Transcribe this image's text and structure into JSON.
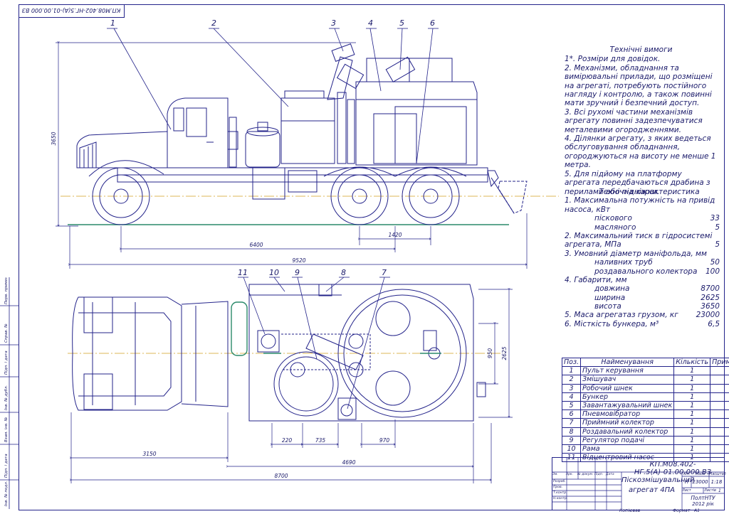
{
  "stamp_top": "КП.М08.402-НГ.5(А)-01.00.000 ВЗ",
  "tech_requirements": {
    "title": "Технічні вимоги",
    "items": [
      "1*. Розміри для довідок.",
      "2. Механізми, обладнання та вимірювальні прилади, що розміщені на агрегаті, потребують постійного нагляду і контролю, а також повинні мати зручний і безпечний доступ.",
      "3. Всі рухомі частини механізмів агрегату повинні задезпечуватися металевими огородженнями.",
      "4. Ділянки агрегату, з яких ведеться обслуговування обладнання, огороджуються на висоту не менше 1 метра.",
      "5. Для підйому на платформу агрегата передбачаються драбина з перилами або підніжки."
    ]
  },
  "specs": {
    "title": "Технічна характеристика",
    "rows": [
      {
        "label": "1. Максимальна потужність на привід",
        "value": ""
      },
      {
        "label": "насоса, кВт",
        "value": ""
      },
      {
        "label": "піскового",
        "value": "33",
        "indent": true
      },
      {
        "label": "масляного",
        "value": "5",
        "indent": true
      },
      {
        "label": "2. Максимальний тиск в гідросистемі",
        "value": ""
      },
      {
        "label": "агрегата, МПа",
        "value": "5"
      },
      {
        "label": "3. Умовний діаметр маніфольда, мм",
        "value": ""
      },
      {
        "label": "наливних труб",
        "value": "50",
        "indent": true
      },
      {
        "label": "роздавального колектора",
        "value": "100",
        "indent": true
      },
      {
        "label": "4. Габарити, мм",
        "value": ""
      },
      {
        "label": "довжина",
        "value": "8700",
        "indent": true
      },
      {
        "label": "ширина",
        "value": "2625",
        "indent": true
      },
      {
        "label": "висота",
        "value": "3650",
        "indent": true
      },
      {
        "label": "5. Маса агрегатаз грузом, кг",
        "value": "23000"
      },
      {
        "label": "6. Місткість бункера, м³",
        "value": "6,5"
      }
    ]
  },
  "parts_table": {
    "headers": [
      "Поз.",
      "Найменування",
      "Кількість",
      "Примітки"
    ],
    "rows": [
      [
        "1",
        "Пульт керування",
        "1",
        ""
      ],
      [
        "2",
        "Змішувач",
        "1",
        ""
      ],
      [
        "3",
        "Робочий шнек",
        "1",
        ""
      ],
      [
        "4",
        "Бункер",
        "1",
        ""
      ],
      [
        "5",
        "Завантажувальний шнек",
        "1",
        ""
      ],
      [
        "6",
        "Пневмовібратор",
        "1",
        ""
      ],
      [
        "7",
        "Приймний колектор",
        "1",
        ""
      ],
      [
        "8",
        "Роздавальний колектор",
        "1",
        ""
      ],
      [
        "9",
        "Регулятор подачі",
        "1",
        ""
      ],
      [
        "10",
        "Рама",
        "1",
        ""
      ],
      [
        "11",
        "Відцентровий насос",
        "1",
        ""
      ]
    ]
  },
  "title_block": {
    "code": "КП.М08.402-НГ.5(А)-01.00.000 ВЗ",
    "name_line1": "Піскозмішувальний",
    "name_line2": "агрегат 4ПА",
    "lit_label": "Літ.",
    "lit_value": "Н",
    "mass_label": "Маса",
    "mass_value": "23000",
    "scale_label": "Масштаб",
    "scale_value": "1:18",
    "sheet_label": "Лист",
    "sheets_label": "Листів",
    "sheets_value": "1",
    "org_line1": "ПолтНТУ",
    "org_line2": "2012 рік",
    "format_label": "Формат",
    "format_value": "А1",
    "copied_label": "Копіював",
    "row_labels": [
      "Зм.",
      "Арк.",
      "№ докум.",
      "Підп.",
      "Дата"
    ],
    "role_labels": [
      "Розроб.",
      "Пров.",
      "Т.контр.",
      "",
      "Н.контр.",
      "Затв."
    ]
  },
  "side_stamp_labels": [
    "Перв. примен.",
    "Справ. №",
    "Підп. і дата",
    "Інв. № дубл.",
    "Взам. інв. №",
    "Підп. і дата",
    "Інв. № подл."
  ],
  "callouts": [
    "1",
    "2",
    "3",
    "4",
    "5",
    "6",
    "7",
    "8",
    "9",
    "10",
    "11"
  ],
  "dimensions": {
    "side_height": "3650",
    "side_1420": "1420",
    "side_6400": "6400",
    "side_9520": "9520",
    "plan_220": "220",
    "plan_735": "735",
    "plan_970": "970",
    "plan_3150": "3150",
    "plan_4690": "4690",
    "plan_8700": "8700",
    "plan_950": "950",
    "plan_2625": "2625"
  }
}
